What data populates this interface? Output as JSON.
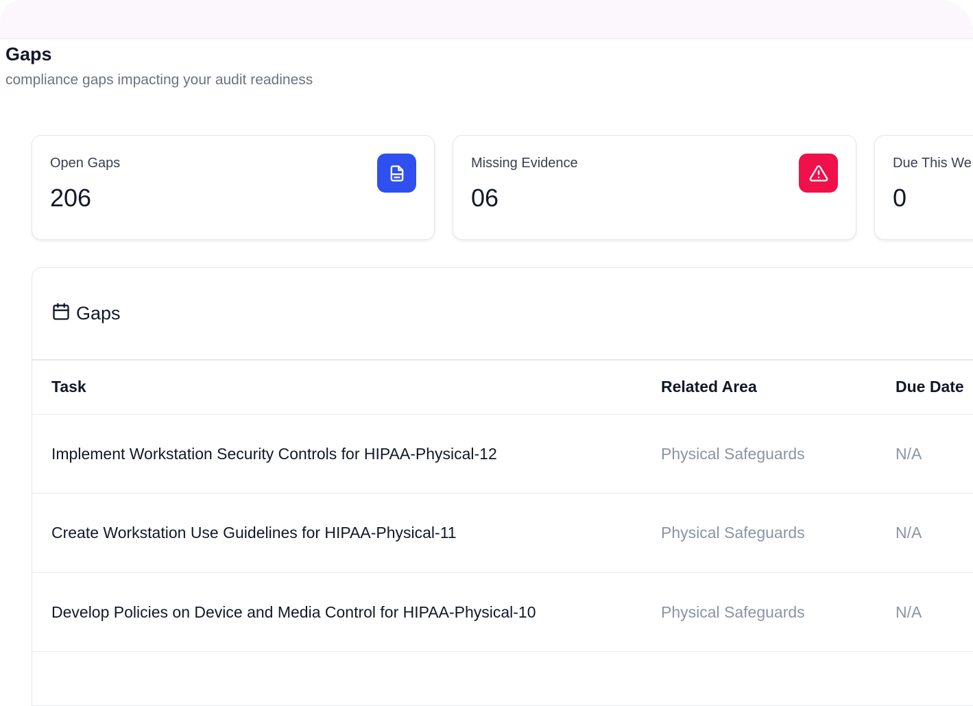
{
  "page": {
    "title": "Gaps",
    "subtitle": "compliance gaps impacting your audit readiness"
  },
  "stats": [
    {
      "label": "Open Gaps",
      "value": "206",
      "icon": "document-icon",
      "icon_color": "#2f50ee"
    },
    {
      "label": "Missing Evidence",
      "value": "06",
      "icon": "alert-triangle-icon",
      "icon_color": "#f0104a"
    },
    {
      "label": "Due This We",
      "value": "0"
    }
  ],
  "gaps_panel": {
    "title": "Gaps",
    "icon": "calendar-icon",
    "columns": [
      "Task",
      "Related Area",
      "Due Date"
    ],
    "rows": [
      {
        "task": "Implement Workstation Security Controls for HIPAA-Physical-12",
        "area": "Physical Safeguards",
        "due": "N/A"
      },
      {
        "task": "Create Workstation Use Guidelines for HIPAA-Physical-11",
        "area": "Physical Safeguards",
        "due": "N/A"
      },
      {
        "task": "Develop Policies on Device and Media Control for HIPAA-Physical-10",
        "area": "Physical Safeguards",
        "due": "N/A"
      }
    ]
  }
}
